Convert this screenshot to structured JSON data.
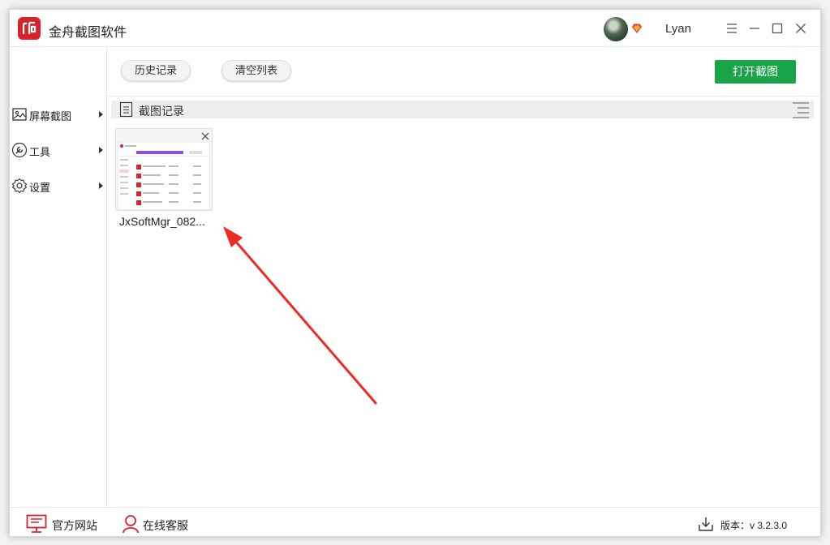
{
  "app": {
    "title": "金舟截图软件",
    "accent": "#d9232a"
  },
  "user": {
    "name": "Lyan"
  },
  "sidebar": {
    "items": [
      {
        "label": "屏幕截图",
        "icon": "image-icon"
      },
      {
        "label": "工具",
        "icon": "wrench-icon"
      },
      {
        "label": "设置",
        "icon": "gear-icon"
      }
    ]
  },
  "toolbar": {
    "history_label": "历史记录",
    "clear_label": "清空列表",
    "open_label": "打开截图",
    "open_color": "#1aa44a"
  },
  "section": {
    "title": "截图记录"
  },
  "files": [
    {
      "name": "JxSoftMgr_082..."
    }
  ],
  "footer": {
    "website_label": "官方网站",
    "support_label": "在线客服",
    "version_label": "版本：v 3.2.3.0",
    "icon_color": "#d9232a"
  },
  "annotation": {
    "color": "#ee2a24"
  }
}
